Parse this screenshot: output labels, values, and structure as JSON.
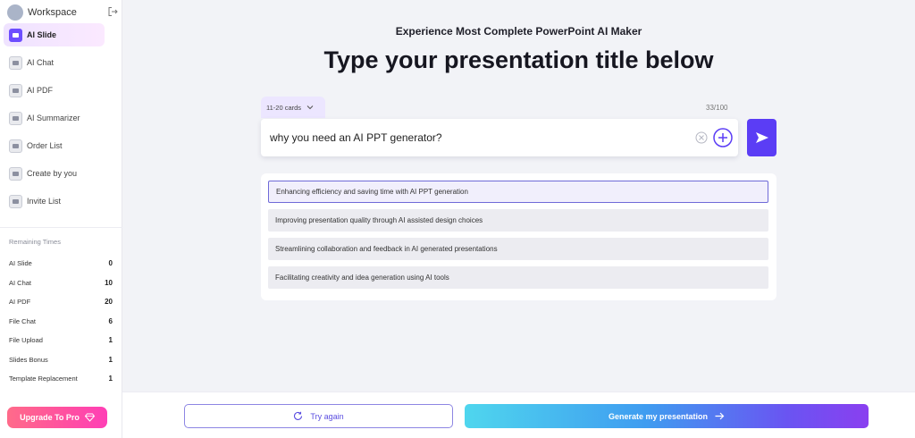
{
  "sidebar": {
    "workspace_label": "Workspace",
    "nav_items": [
      {
        "label": "AI Slide",
        "icon": "slide-icon",
        "active": true
      },
      {
        "label": "AI Chat",
        "icon": "chat-icon"
      },
      {
        "label": "AI PDF",
        "icon": "pdf-icon"
      },
      {
        "label": "AI Summarizer",
        "icon": "summarizer-icon"
      },
      {
        "label": "Order List",
        "icon": "order-list-icon"
      },
      {
        "label": "Create by you",
        "icon": "create-icon"
      },
      {
        "label": "Invite List",
        "icon": "invite-icon"
      }
    ],
    "remaining_title": "Remaining Times",
    "remaining": [
      {
        "label": "AI Slide",
        "value": "0"
      },
      {
        "label": "AI Chat",
        "value": "10"
      },
      {
        "label": "AI PDF",
        "value": "20"
      },
      {
        "label": "File Chat",
        "value": "6"
      },
      {
        "label": "File Upload",
        "value": "1"
      },
      {
        "label": "Slides Bonus",
        "value": "1"
      },
      {
        "label": "Template Replacement",
        "value": "1"
      }
    ],
    "upgrade_label": "Upgrade To Pro"
  },
  "main": {
    "subtitle": "Experience Most Complete PowerPoint AI Maker",
    "title": "Type your presentation title below",
    "cards_selector": "11-20 cards",
    "char_counter": "33/100",
    "input_value": "why you need an AI PPT generator?",
    "suggestions": [
      "Enhancing efficiency and saving time with AI PPT generation",
      "Improving presentation quality through AI assisted design choices",
      "Streamlining collaboration and feedback in AI generated presentations",
      "Facilitating creativity and idea generation using AI tools"
    ]
  },
  "footer": {
    "try_again_label": "Try again",
    "generate_label": "Generate my presentation"
  },
  "colors": {
    "accent": "#5b3df5",
    "upgrade_gradient_start": "#ff6b8a",
    "upgrade_gradient_end": "#ff3fb6"
  }
}
